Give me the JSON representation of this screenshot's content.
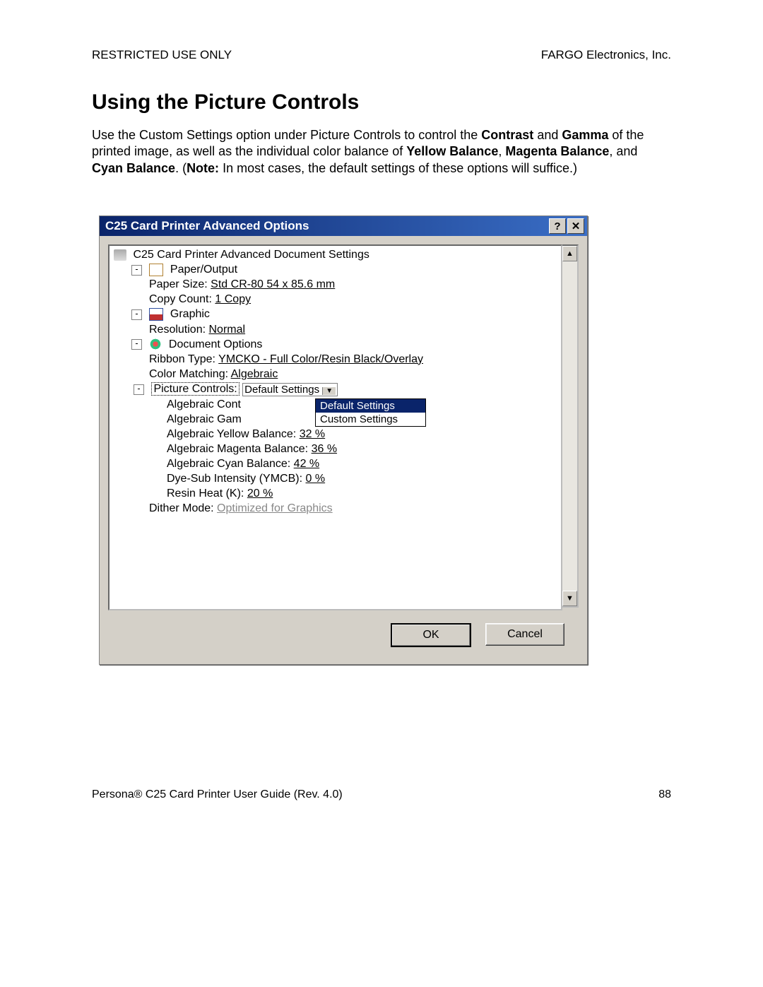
{
  "header": {
    "left": "RESTRICTED USE ONLY",
    "right": "FARGO Electronics, Inc."
  },
  "section_title": "Using the Picture Controls",
  "body_parts": {
    "p1": "Use the Custom Settings option under Picture Controls to control the ",
    "b1": "Contrast",
    "p2": " and ",
    "b2": "Gamma",
    "p3": " of the printed image, as well as the individual color balance of ",
    "b3": "Yellow Balance",
    "p4": ", ",
    "b4": "Magenta Balance",
    "p5": ", and ",
    "b5": "Cyan Balance",
    "p6": ".  (",
    "b6": "Note:",
    "p7": " In most cases, the default settings of these options will suffice.)"
  },
  "dialog": {
    "title": "C25 Card Printer Advanced Options",
    "root": "C25 Card Printer Advanced Document Settings",
    "paper_output": {
      "label": "Paper/Output",
      "paper_size_label": "Paper Size:",
      "paper_size_value": "Std CR-80  54 x 85.6 mm",
      "copy_count_label": "Copy Count:",
      "copy_count_value": "1 Copy"
    },
    "graphic": {
      "label": "Graphic",
      "resolution_label": "Resolution:",
      "resolution_value": "Normal"
    },
    "doc_options": {
      "label": "Document Options",
      "ribbon_label": "Ribbon Type:",
      "ribbon_value": "YMCKO - Full Color/Resin Black/Overlay",
      "color_match_label": "Color Matching:",
      "color_match_value": "Algebraic",
      "picture_controls_label": "Picture Controls:",
      "picture_controls_selected": "Default Settings",
      "picture_controls_options": {
        "o1": "Default Settings",
        "o2": "Custom Settings"
      },
      "algebraic_cont_partial": "Algebraic Cont",
      "algebraic_gam_partial": "Algebraic Gam",
      "yellow_label": "Algebraic Yellow Balance:",
      "yellow_value": "32 %",
      "magenta_label": "Algebraic Magenta Balance:",
      "magenta_value": "36 %",
      "cyan_label": "Algebraic Cyan Balance:",
      "cyan_value": "42 %",
      "dyesub_label": "Dye-Sub Intensity (YMCB):",
      "dyesub_value": "0 %",
      "resinheat_label": "Resin Heat (K):",
      "resinheat_value": "20 %",
      "dither_label": "Dither Mode:",
      "dither_value": "Optimized for Graphics"
    },
    "buttons": {
      "ok": "OK",
      "cancel": "Cancel"
    }
  },
  "footer": {
    "left": "Persona® C25 Card Printer User Guide (Rev. 4.0)",
    "right": "88"
  }
}
